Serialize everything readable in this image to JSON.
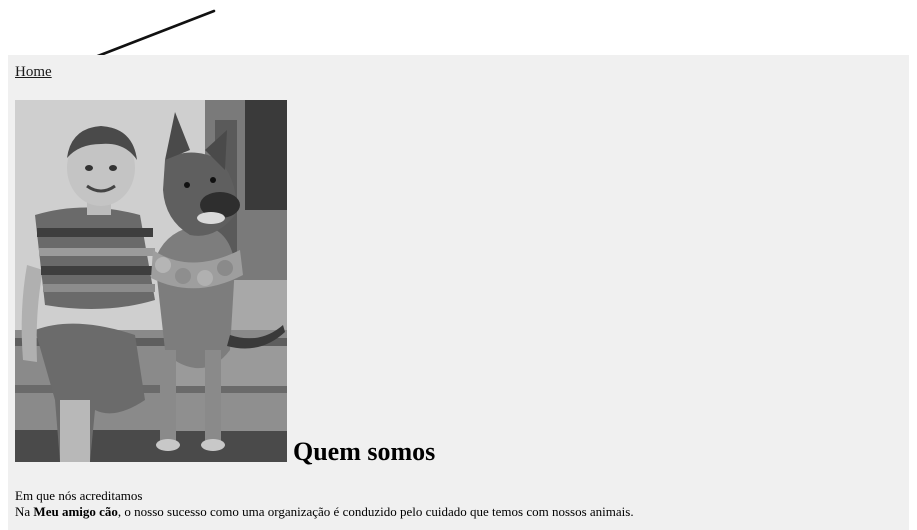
{
  "nav": {
    "home_label": "Home"
  },
  "hero": {
    "image_alt": "Menino sentado numa escada ao lado de um cão"
  },
  "main": {
    "heading": "Quem somos",
    "subheading": "Em que nós acreditamos",
    "body_prefix": "Na ",
    "brand_name": "Meu amigo cão",
    "body_rest": ", o nosso sucesso como uma organização é conduzido pelo cuidado que temos com nossos animais."
  },
  "annotation": {
    "pointer_icon": "arrow-icon"
  }
}
